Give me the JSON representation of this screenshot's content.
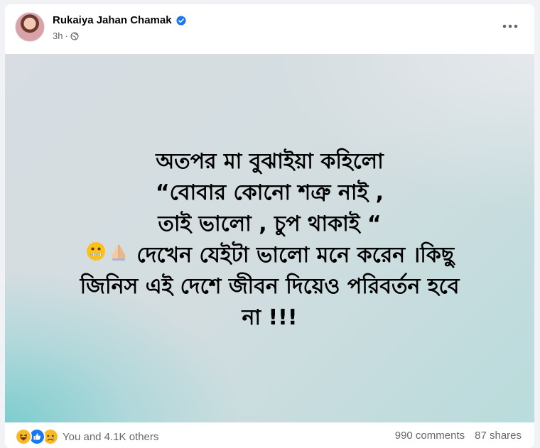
{
  "post": {
    "author": "Rukaiya Jahan Chamak",
    "time": "3h",
    "separator": "·",
    "audience_icon": "globe-icon",
    "verified_icon": "verified-badge-icon",
    "more_icon": "more-horizontal-icon"
  },
  "status": {
    "line1": "অতপর মা বুঝাইয়া কহিলো",
    "line2": "“বোবার কোনো শত্রু নাই ,",
    "line3": "তাই ভালো , চুপ থাকাই “",
    "line4_emojis": "🤐🙏",
    "line4": "দেখেন যেইটা ভালো মনে করেন ।কিছু",
    "line5": "জিনিস এই দেশে জীবন দিয়েও পরিবর্তন হবে",
    "line6": "না !!!",
    "background_colors": {
      "top_right": "#e8eaee",
      "bottom_left": "#78ccce"
    }
  },
  "footer": {
    "reaction_icons": [
      "haha-icon",
      "like-icon",
      "sad-icon"
    ],
    "reactions_text": "You and 4.1K others",
    "comments": "990 comments",
    "shares": "87 shares"
  },
  "colors": {
    "verified": "#1877f2",
    "like": "#1877f2",
    "haha": "#f7b928",
    "secondary_text": "#65676b"
  }
}
